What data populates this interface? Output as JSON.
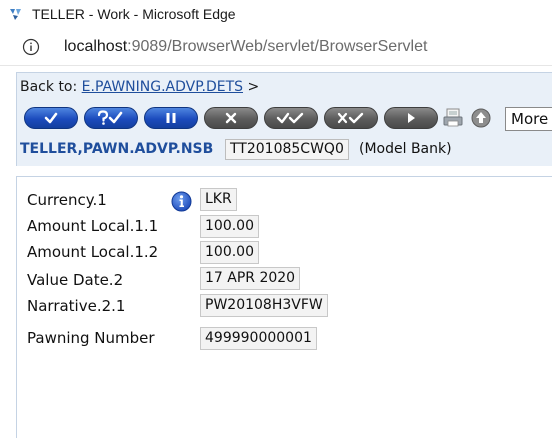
{
  "window": {
    "title": "TELLER - Work - Microsoft Edge",
    "url_host": "localhost",
    "url_rest": ":9089/BrowserWeb/servlet/BrowserServlet"
  },
  "header": {
    "back_to_label": "Back to:",
    "back_to_link": "E.PAWNING.ADVP.DETS",
    "back_to_suffix": ">",
    "more_actions": "More A",
    "application": "TELLER,PAWN.ADVP.NSB",
    "record_id": "TT201085CWQ0",
    "company": "(Model Bank)"
  },
  "toolbar": {
    "buttons": [
      {
        "name": "commit-button",
        "icon": "check-icon",
        "color": "blue"
      },
      {
        "name": "validate-button",
        "icon": "question-check-icon",
        "color": "blue"
      },
      {
        "name": "hold-button",
        "icon": "pause-icon",
        "color": "blue"
      },
      {
        "name": "delete-button",
        "icon": "x-icon",
        "color": "gray"
      },
      {
        "name": "authorise-button",
        "icon": "double-check-icon",
        "color": "gray"
      },
      {
        "name": "reverse-button",
        "icon": "x-check-icon",
        "color": "gray"
      },
      {
        "name": "next-button",
        "icon": "play-icon",
        "color": "gray"
      }
    ]
  },
  "fields": [
    {
      "label": "Currency.1",
      "value": "LKR"
    },
    {
      "label": "Amount Local.1.1",
      "value": "100.00"
    },
    {
      "label": "Amount Local.1.2",
      "value": "100.00"
    },
    {
      "label": "Value Date.2",
      "value": "17 APR 2020"
    },
    {
      "label": "Narrative.2.1",
      "value": "PW20108H3VFW"
    },
    {
      "label": "Pawning Number",
      "value": "499990000001"
    }
  ],
  "colors": {
    "header_bg": "#e9f0f8",
    "link": "#1f4e9c",
    "button_blue": "#1c4bbd",
    "button_gray": "#5c5c5c"
  }
}
